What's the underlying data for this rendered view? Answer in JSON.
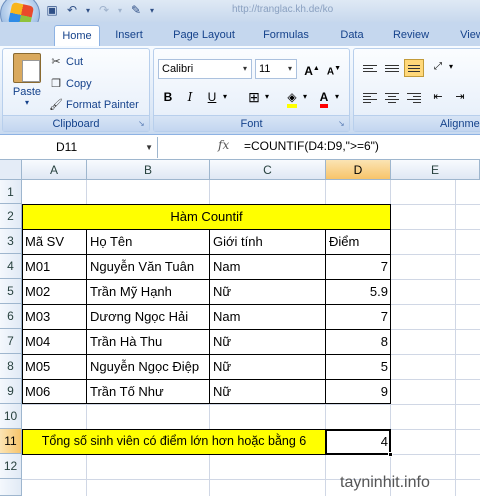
{
  "qat": {
    "icons": [
      "save-icon",
      "undo-icon",
      "redo-icon",
      "format-painter-icon"
    ]
  },
  "url_title": "http://tranglac.kh.de/ko",
  "tabs": [
    {
      "label": "Home",
      "active": true
    },
    {
      "label": "Insert",
      "active": false
    },
    {
      "label": "Page Layout",
      "active": false
    },
    {
      "label": "Formulas",
      "active": false
    },
    {
      "label": "Data",
      "active": false
    },
    {
      "label": "Review",
      "active": false
    },
    {
      "label": "View",
      "active": false
    }
  ],
  "clipboard": {
    "paste_label": "Paste",
    "cut_label": "Cut",
    "copy_label": "Copy",
    "format_painter_label": "Format Painter",
    "group_label": "Clipboard"
  },
  "font": {
    "font_name": "Calibri",
    "font_size": "11",
    "group_label": "Font",
    "bold": "B",
    "italic": "I",
    "underline": "U",
    "grow": "A",
    "shrink": "A"
  },
  "alignment": {
    "group_label": "Alignment"
  },
  "formula_bar": {
    "name_box": "D11",
    "fx_label": "fx",
    "formula": "=COUNTIF(D4:D9,\">=6\")"
  },
  "columns": [
    {
      "label": "A",
      "selected": false
    },
    {
      "label": "B",
      "selected": false
    },
    {
      "label": "C",
      "selected": false
    },
    {
      "label": "D",
      "selected": true
    },
    {
      "label": "E",
      "selected": false
    }
  ],
  "rows": [
    {
      "label": "1",
      "selected": false
    },
    {
      "label": "2",
      "selected": false
    },
    {
      "label": "3",
      "selected": false
    },
    {
      "label": "4",
      "selected": false
    },
    {
      "label": "5",
      "selected": false
    },
    {
      "label": "6",
      "selected": false
    },
    {
      "label": "7",
      "selected": false
    },
    {
      "label": "8",
      "selected": false
    },
    {
      "label": "9",
      "selected": false
    },
    {
      "label": "10",
      "selected": false
    },
    {
      "label": "11",
      "selected": true
    },
    {
      "label": "12",
      "selected": false
    }
  ],
  "sheet": {
    "title": "Hàm Countif",
    "headers": [
      "Mã SV",
      "Họ Tên",
      "Giới tính",
      "Điểm"
    ],
    "records": [
      [
        "M01",
        "Nguyễn Văn Tuân",
        "Nam",
        "7"
      ],
      [
        "M02",
        "Trần Mỹ Hạnh",
        "Nữ",
        "5.9"
      ],
      [
        "M03",
        "Dương Ngọc Hải",
        "Nam",
        "7"
      ],
      [
        "M04",
        "Trần Hà Thu",
        "Nữ",
        "8"
      ],
      [
        "M05",
        "Nguyễn Ngọc Điệp",
        "Nữ",
        "5"
      ],
      [
        "M06",
        "Trần Tố Như",
        "Nữ",
        "9"
      ]
    ],
    "summary_label": "Tổng số sinh viên có điểm lớn hơn hoặc bằng 6",
    "summary_value": "4"
  },
  "colors": {
    "highlight": "#ffff00",
    "selected_header": "#f7c46a"
  },
  "watermark": "tayninhit.info"
}
